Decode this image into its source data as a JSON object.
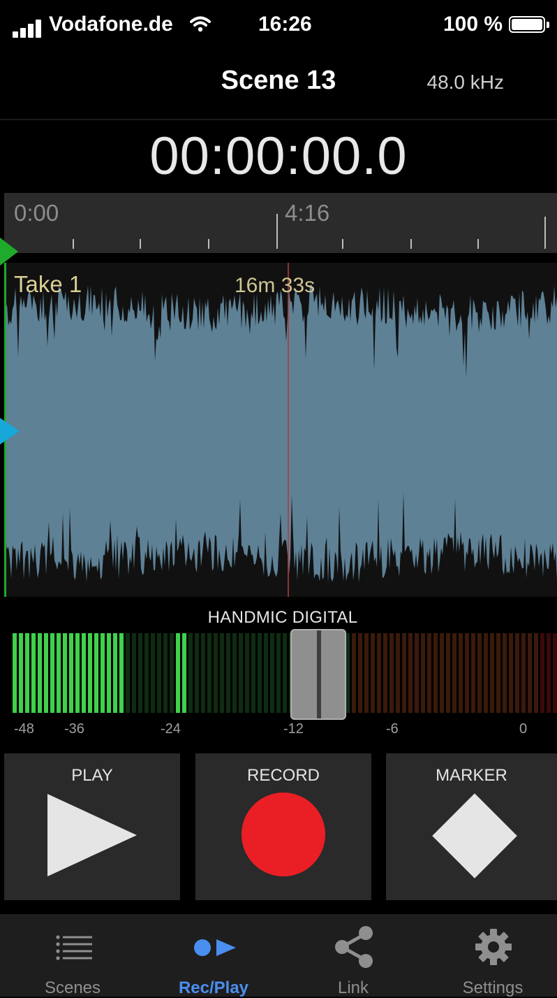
{
  "status_bar": {
    "carrier": "Vodafone.de",
    "time": "16:26",
    "battery": "100 %",
    "icons": [
      "signal-icon",
      "wifi-icon",
      "battery-icon"
    ]
  },
  "header": {
    "title": "Scene 13",
    "sample_rate": "48.0 kHz"
  },
  "timecode": "00:00:00.0",
  "timeline": {
    "start_label": "0:00",
    "mid_label": "4:16"
  },
  "take": {
    "name": "Take 1",
    "duration": "16m 33s"
  },
  "meter": {
    "input_name": "HANDMIC DIGITAL",
    "scale": [
      "-48",
      "-36",
      "-24",
      "-12",
      "-6",
      "0"
    ],
    "colors": {
      "green": "#3fd14b",
      "dim_green": "#0f2c13",
      "dim_orange": "#3a1a0b",
      "dim_red": "#3a0909"
    }
  },
  "transport": {
    "play_label": "PLAY",
    "record_label": "RECORD",
    "marker_label": "MARKER",
    "record_color": "#ea1f25"
  },
  "tabs": [
    {
      "label": "Scenes",
      "icon": "list-icon",
      "active": false
    },
    {
      "label": "Rec/Play",
      "icon": "rec-play-icon",
      "active": true
    },
    {
      "label": "Link",
      "icon": "share-icon",
      "active": false
    },
    {
      "label": "Settings",
      "icon": "gear-icon",
      "active": false
    }
  ],
  "colors": {
    "accent": "#4a8ff0",
    "waveform": "#5e8196",
    "take_label": "#d9cf93"
  }
}
